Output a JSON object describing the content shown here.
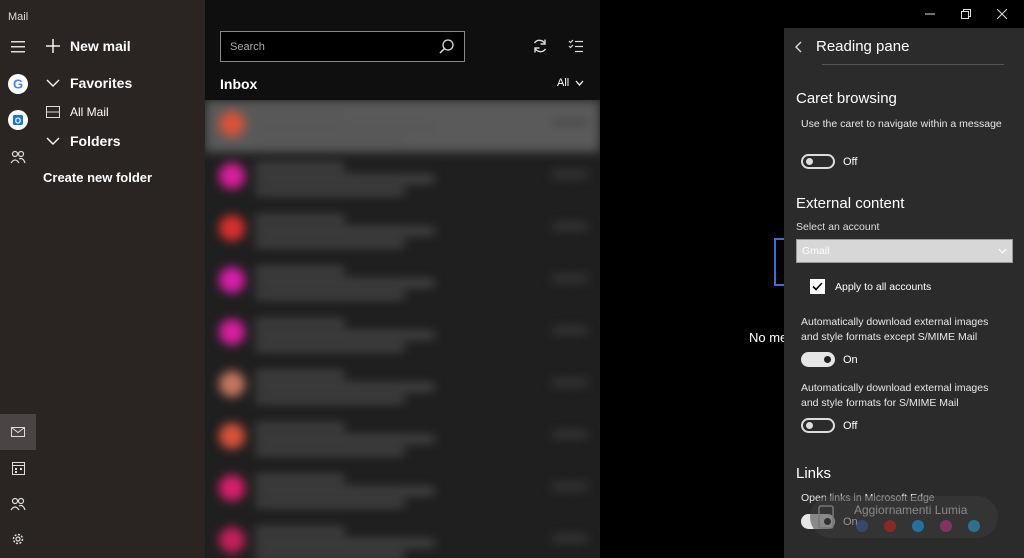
{
  "app": {
    "title": "Mail"
  },
  "folder_pane": {
    "new_mail": "New mail",
    "favorites": "Favorites",
    "all_mail": "All Mail",
    "folders": "Folders",
    "create_folder": "Create new folder"
  },
  "list": {
    "search_placeholder": "Search",
    "inbox_title": "Inbox",
    "filter_label": "All",
    "avatar_colors": [
      "#d9533a",
      "#d91f9e",
      "#d9302e",
      "#d91fa8",
      "#d91f9e",
      "#c2775f",
      "#d9533a",
      "#d91f6e",
      "#c41f5c"
    ]
  },
  "reading": {
    "empty_text": "No me"
  },
  "settings": {
    "title": "Reading pane",
    "caret": {
      "title": "Caret browsing",
      "desc": "Use the caret to navigate within a message",
      "toggle_state": "Off"
    },
    "external": {
      "title": "External content",
      "select_label": "Select an account",
      "account_value": "Gmail",
      "apply_all": "Apply to all accounts",
      "apply_all_checked": true,
      "auto_desc": "Automatically download external images and style formats except S/MIME Mail",
      "auto_state": "On",
      "smime_desc": "Automatically download external images and style formats for S/MIME Mail",
      "smime_state": "Off"
    },
    "links": {
      "title": "Links",
      "desc": "Open links in Microsoft Edge",
      "state": "On"
    }
  },
  "watermark": {
    "text": "Aggiornamenti Lumia"
  }
}
